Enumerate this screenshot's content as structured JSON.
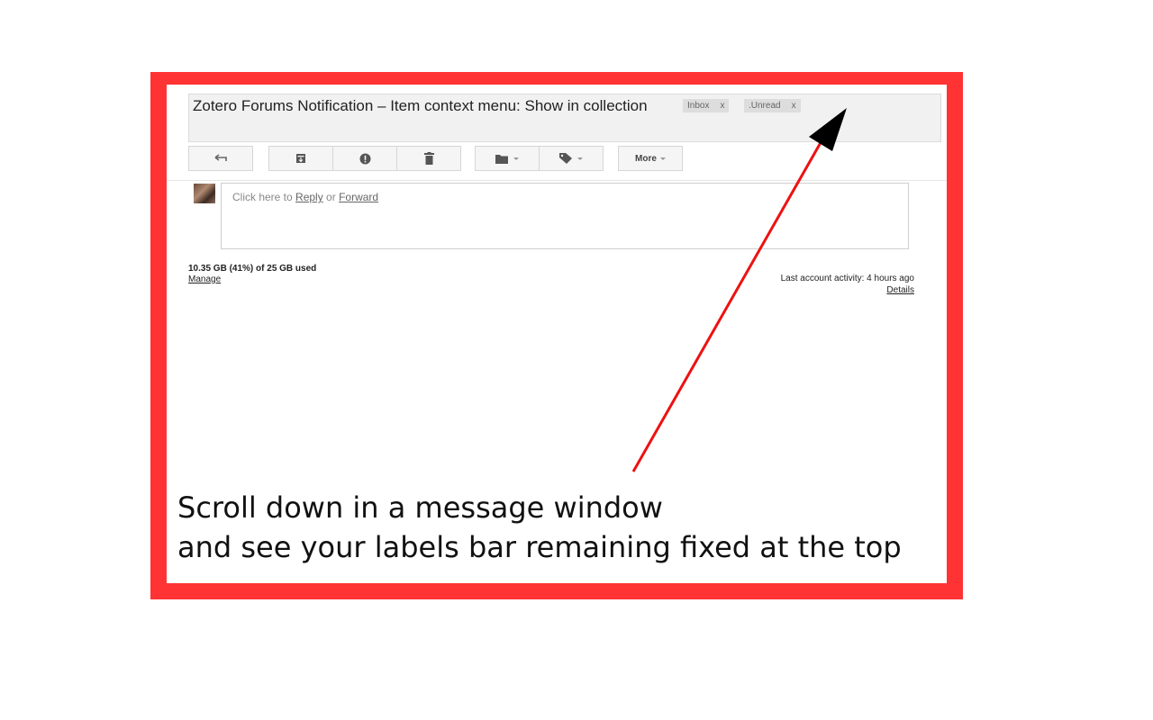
{
  "email": {
    "subject": "Zotero Forums Notification – Item context menu: Show in collection",
    "labels": [
      {
        "name": "Inbox",
        "remove": "x"
      },
      {
        "name": ".Unread",
        "remove": "x"
      }
    ]
  },
  "toolbar": {
    "buttons": [
      {
        "icon": "back-arrow-icon"
      },
      {
        "icon": "archive-icon"
      },
      {
        "icon": "report-spam-icon"
      },
      {
        "icon": "delete-icon"
      },
      {
        "icon": "move-to-folder-icon"
      },
      {
        "icon": "labels-tag-icon"
      }
    ],
    "more_label": "More"
  },
  "reply": {
    "prefix": "Click here to ",
    "reply_link": "Reply",
    "middle": " or ",
    "forward_link": "Forward"
  },
  "footer": {
    "storage": "10.35 GB (41%) of 25 GB used",
    "manage": "Manage",
    "last_activity": "Last account activity: 4 hours ago",
    "details": "Details"
  },
  "caption": {
    "line1": "Scroll down in a message window",
    "line2": "and see your labels bar remaining fixed at the top"
  },
  "colors": {
    "frame": "#ff3333",
    "arrow_line": "#ee1111",
    "arrow_head": "#000000"
  }
}
